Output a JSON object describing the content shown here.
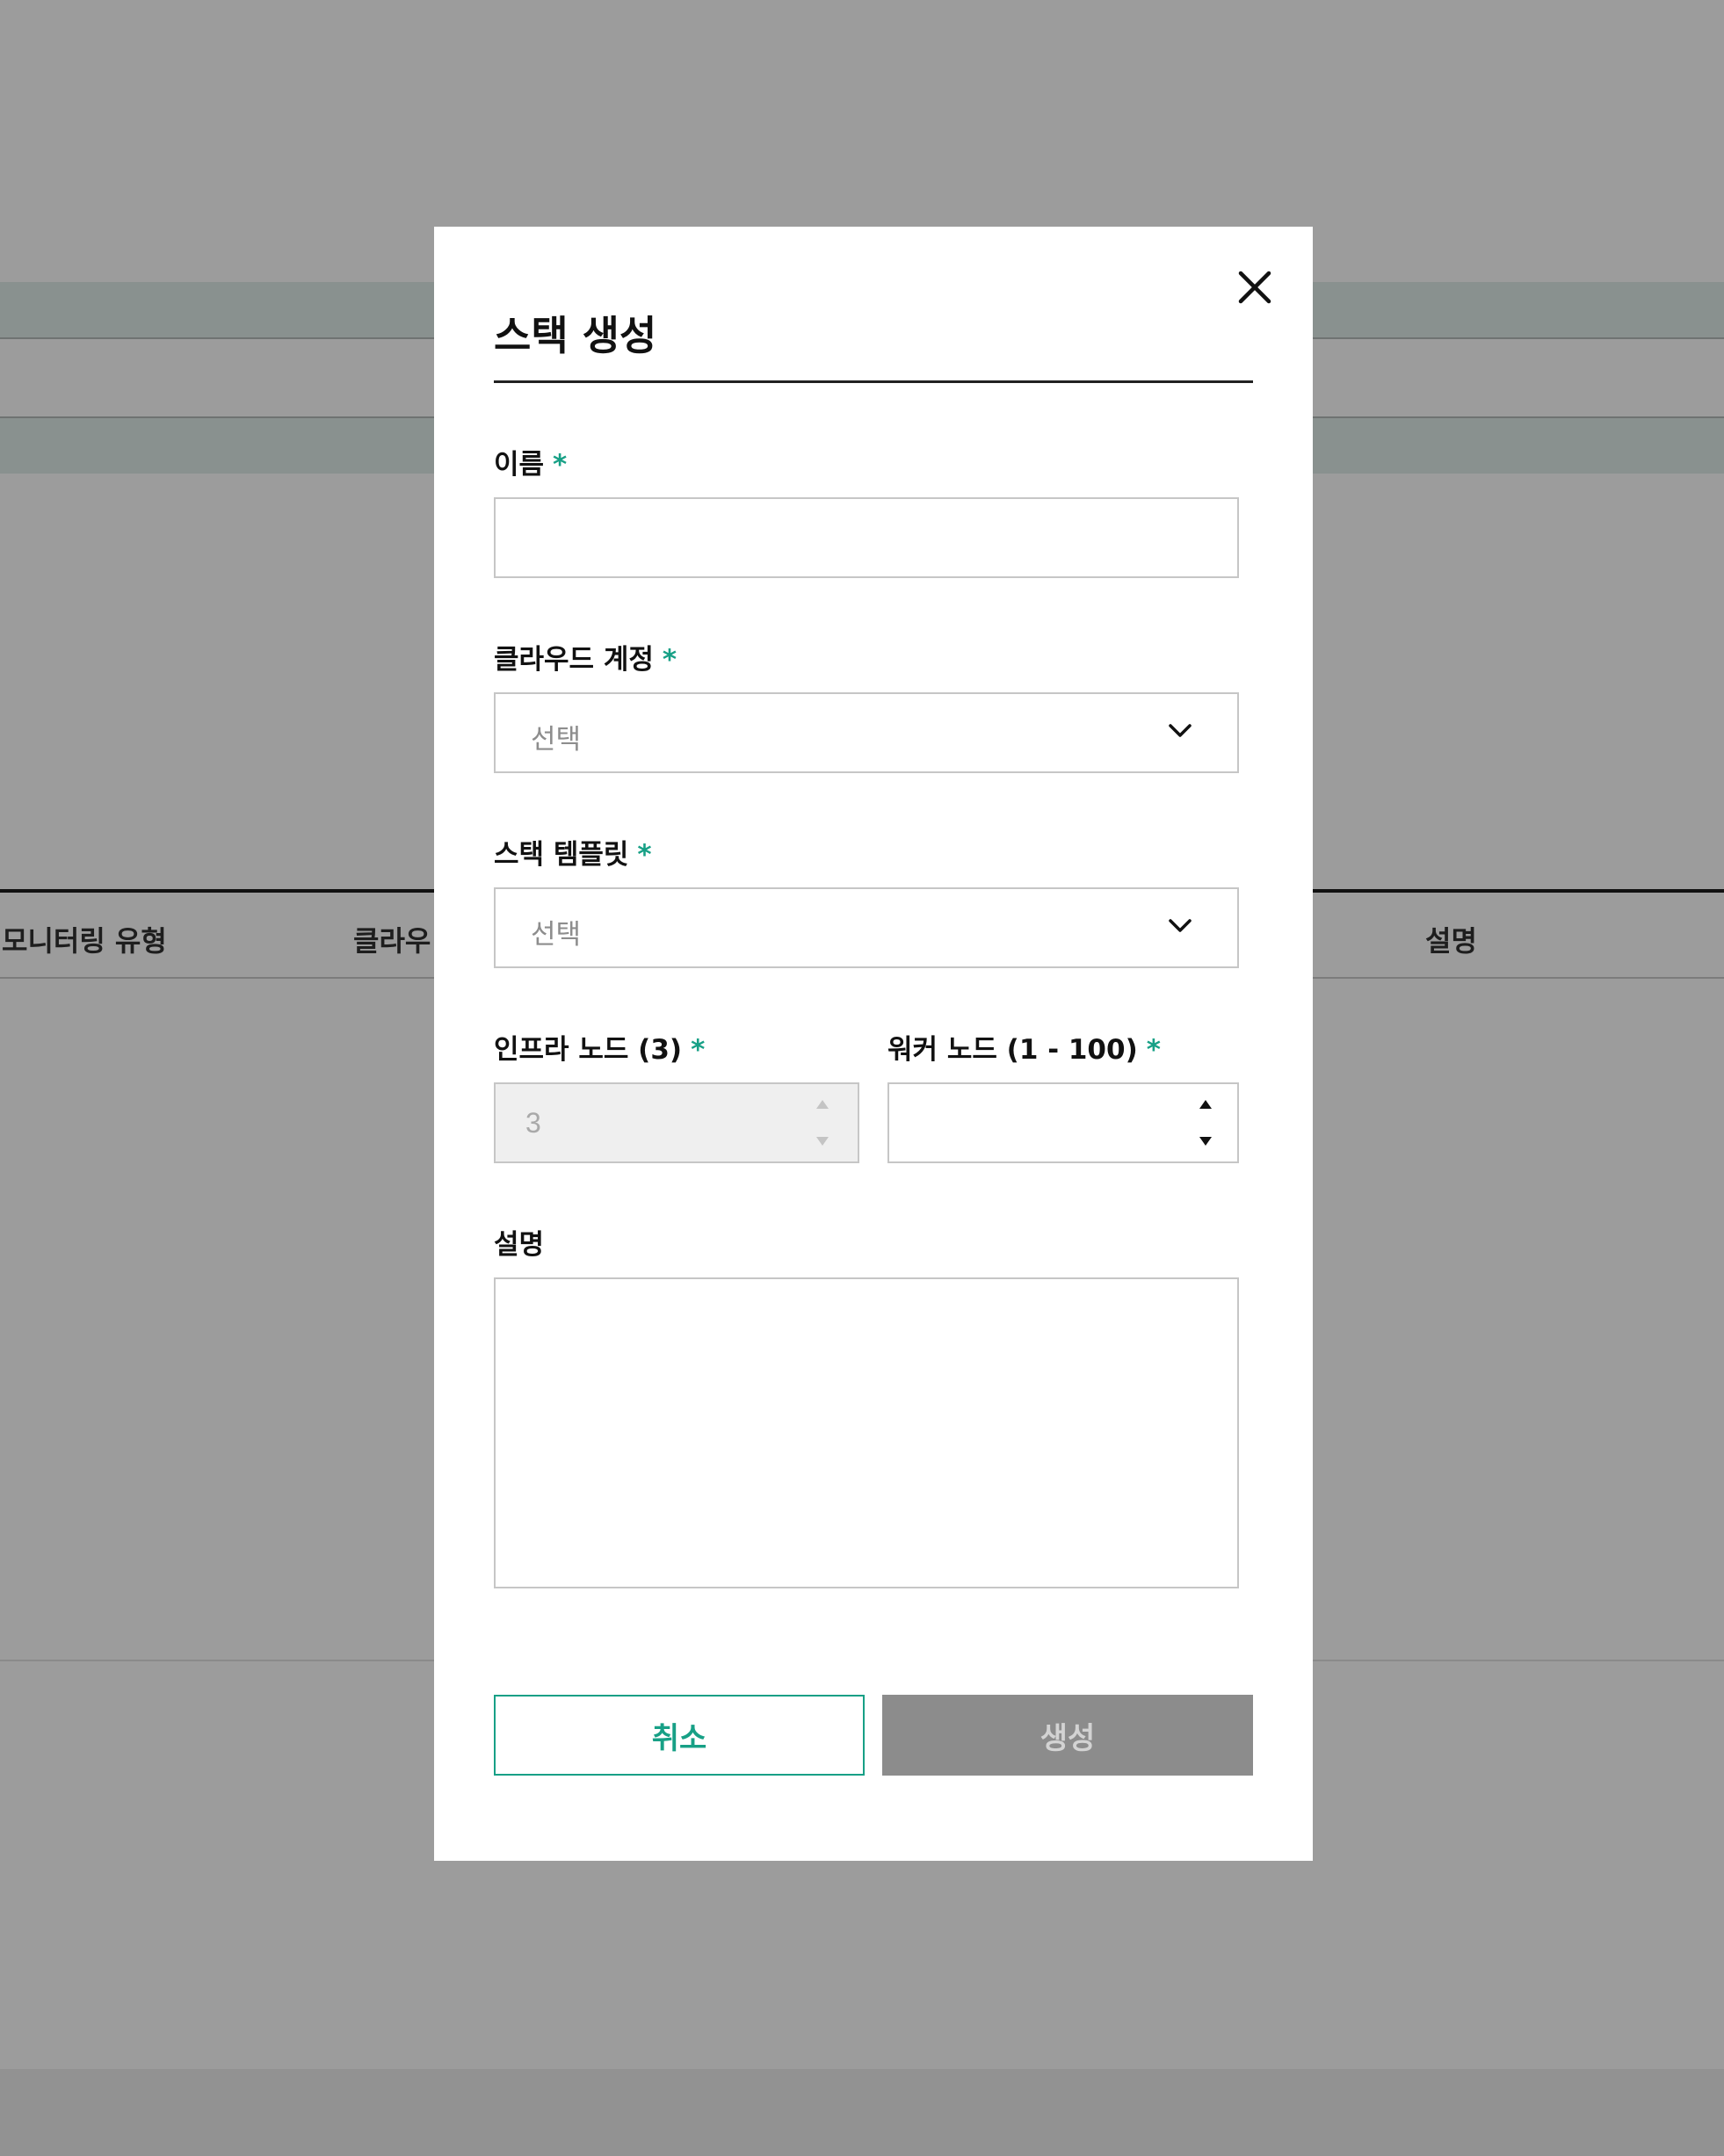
{
  "background": {
    "table_columns": [
      "모니터링 유형",
      "클라우",
      "설명"
    ]
  },
  "modal": {
    "title": "스택 생성",
    "close_icon": "close-icon",
    "fields": {
      "name": {
        "label": "이름",
        "required_mark": "*",
        "value": ""
      },
      "cloud_account": {
        "label": "클라우드 계정",
        "required_mark": "*",
        "selected": "선택"
      },
      "stack_template": {
        "label": "스택 템플릿",
        "required_mark": "*",
        "selected": "선택"
      },
      "infra_nodes": {
        "label": "인프라 노드 (3)",
        "required_mark": "*",
        "value": "3",
        "disabled": true
      },
      "worker_nodes": {
        "label": "워커 노드 (1 - 100)",
        "required_mark": "*",
        "value": ""
      },
      "description": {
        "label": "설명",
        "value": ""
      }
    },
    "buttons": {
      "cancel": "취소",
      "create": "생성"
    }
  },
  "colors": {
    "accent": "#17a086",
    "overlay": "#9c9c9c",
    "disabled_button": "#8c8c8c"
  }
}
